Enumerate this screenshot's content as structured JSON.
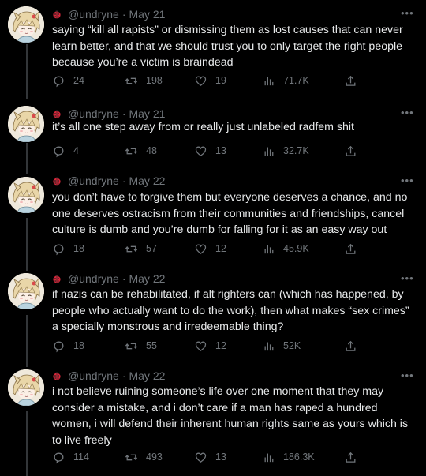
{
  "tweets": [
    {
      "handle": "@undryne",
      "date": "May 21",
      "text": "saying “kill all rapists” or dismissing them as lost causes that can never learn better, and that we should trust you to only target the right people because you’re a victim is braindead",
      "replies": "24",
      "retweets": "198",
      "likes": "19",
      "views": "71.7K"
    },
    {
      "handle": "@undryne",
      "date": "May 21",
      "text": "it’s all one step away from or really just unlabeled radfem shit",
      "replies": "4",
      "retweets": "48",
      "likes": "13",
      "views": "32.7K"
    },
    {
      "handle": "@undryne",
      "date": "May 22",
      "text": "you don’t have to forgive them but everyone deserves a chance, and no one deserves ostracism from their communities and friendships, cancel culture is dumb and you’re dumb for falling for it as an easy way out",
      "replies": "18",
      "retweets": "57",
      "likes": "12",
      "views": "45.9K"
    },
    {
      "handle": "@undryne",
      "date": "May 22",
      "text": "if nazis can be rehabilitated, if alt righters can (which has happened, by people who actually want to do the work), then what makes “sex crimes” a specially monstrous and irredeemable thing?",
      "replies": "18",
      "retweets": "55",
      "likes": "12",
      "views": "52K"
    },
    {
      "handle": "@undryne",
      "date": "May 22",
      "text": "i not believe ruining someone’s life over one moment that they may consider a mistake, and i don’t care if a man has raped a hundred women, i will defend their inherent human rights same as yours which is to live freely",
      "replies": "114",
      "retweets": "493",
      "likes": "13",
      "views": "186.3K"
    }
  ],
  "ui": {
    "separator": "·",
    "more_glyph": "•••",
    "name_emoji_icon": "ladybug-icon",
    "thread_line_color": "#333639",
    "text_color": "#e7e9ea",
    "muted_color": "#71767b",
    "background": "#000000"
  }
}
